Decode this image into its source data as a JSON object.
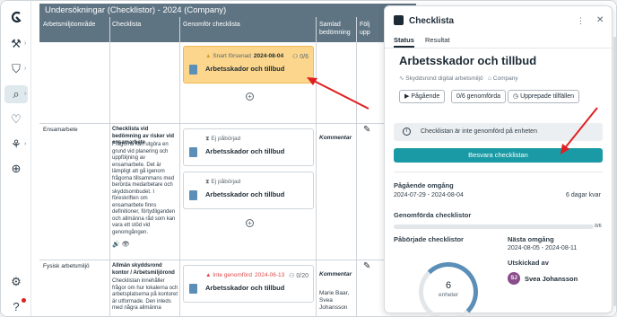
{
  "table": {
    "title": "Undersökningar (Checklistor) - 2024 (Company)",
    "columns": [
      "Arbetsmiljöområde",
      "Checklista",
      "Genomför checklista",
      "Samlad bedömning",
      "Följ upp"
    ],
    "rows": [
      {
        "category": "",
        "checklist_title": "",
        "checklist_desc": "",
        "cards": [
          {
            "status": "Snart försenad",
            "date": "2024-08-04",
            "name": "Arbetsskador och tillbud",
            "count": "0/6"
          }
        ],
        "comment": "",
        "names": ""
      },
      {
        "category": "Ensamarbete",
        "checklist_title": "Checklista vid bedömning av risker vid ensamarbete",
        "checklist_desc": "Frågorna kan utgöra en grund vid planering och uppföljning av ensamarbete. Det är lämpligt att gå igenom frågorna tillsammans med berörda medarbetare och skyddsombudet. I föreskriften om ensamarbete finns definitioner, förtydliganden och allmänna råd som kan vara ett stöd vid genomgången.",
        "cards": [
          {
            "status": "Ej påbörjad",
            "date": "",
            "name": "Arbetsskador och tillbud",
            "count": ""
          },
          {
            "status": "Ej påbörjad",
            "date": "",
            "name": "Arbetsskador och tillbud",
            "count": ""
          }
        ],
        "comment": "Kommentar",
        "names": ""
      },
      {
        "category": "Fysisk arbetsmiljö",
        "checklist_title": "Allmän skyddsrond kontor / Arbetsmiljörond",
        "checklist_desc": "Checklistan innehåller frågor om hur lokalerna och arbetsplatserna på kontoret är utformade. Den inleds med några allmänna",
        "cards": [
          {
            "status": "Inte genomförd",
            "date": "2024-06-13",
            "name": "Arbetsskador och tillbud",
            "count": "0/20"
          }
        ],
        "comment": "Kommentar",
        "names": "Marie Baar, Svea Johansson"
      }
    ]
  },
  "panel": {
    "header": "Checklista",
    "tabs": [
      "Status",
      "Resultat"
    ],
    "title": "Arbetsskador och tillbud",
    "meta_source": "Skyddsrond digital arbetsmiljö",
    "meta_company": "Company",
    "buttons": [
      "Pågående",
      "0/6 genomförda",
      "Upprepade tillfällen"
    ],
    "info": "Checklistan är inte genomförd på enheten",
    "cta": "Besvara checklistan",
    "ongoing_label": "Pågående omgång",
    "ongoing_dates": "2024-07-29 - 2024-08-04",
    "days_left": "6 dagar kvar",
    "done_label": "Genomförda checklistor",
    "done_value": "0/6",
    "done_fraction": 0,
    "started_label": "Påbörjade checklistor",
    "gauge_value": "6",
    "gauge_unit": "enheter",
    "next_label": "Nästa omgång",
    "next_dates": "2024-08-05 - 2024-08-11",
    "sent_label": "Utskickad av",
    "sender_initials": "SJ",
    "sender_name": "Svea Johansson"
  },
  "colors": {
    "accent": "#1a9aa5",
    "header": "#5f7483",
    "highlight": "#fbd68c",
    "red": "#d94b4b",
    "annotation": "#e02020"
  }
}
